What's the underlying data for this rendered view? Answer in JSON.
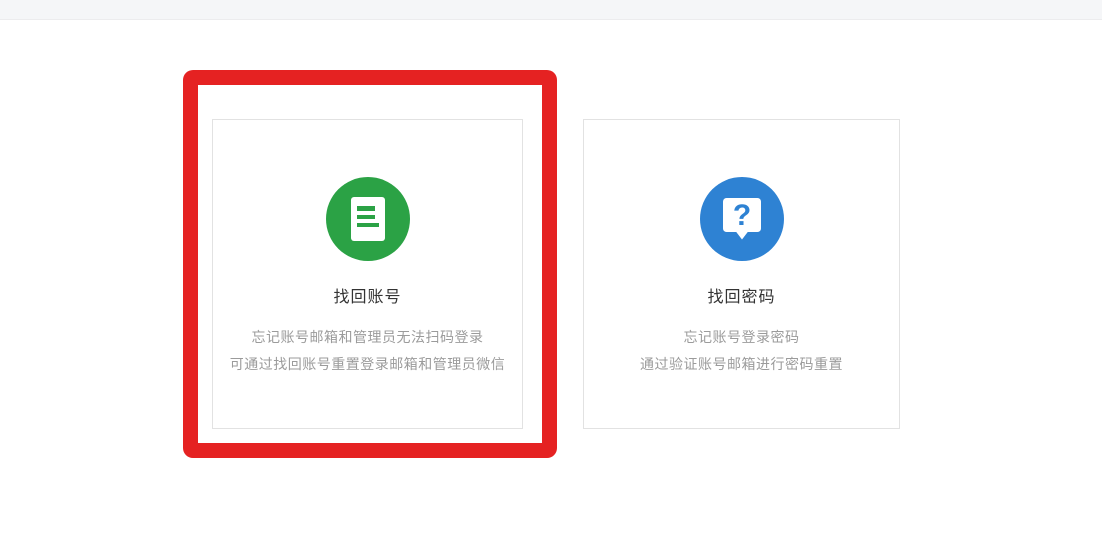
{
  "colors": {
    "green": "#2BA245",
    "blue": "#2E82D3",
    "red": "#E52222",
    "card-border": "#e2e2e2",
    "title-color": "#333333",
    "desc-color": "#9b9b9b",
    "topbar-bg": "#f5f6f8"
  },
  "annotation": {
    "shape": "rectangle",
    "color": "#E52222",
    "target": "recover-account-card"
  },
  "cards": [
    {
      "id": "recover-account",
      "icon": "document-icon",
      "icon_color": "#2BA245",
      "title": "找回账号",
      "desc_line1": "忘记账号邮箱和管理员无法扫码登录",
      "desc_line2": "可通过找回账号重置登录邮箱和管理员微信"
    },
    {
      "id": "recover-password",
      "icon": "question-bubble-icon",
      "icon_color": "#2E82D3",
      "icon_glyph": "?",
      "title": "找回密码",
      "desc_line1": "忘记账号登录密码",
      "desc_line2": "通过验证账号邮箱进行密码重置"
    }
  ]
}
